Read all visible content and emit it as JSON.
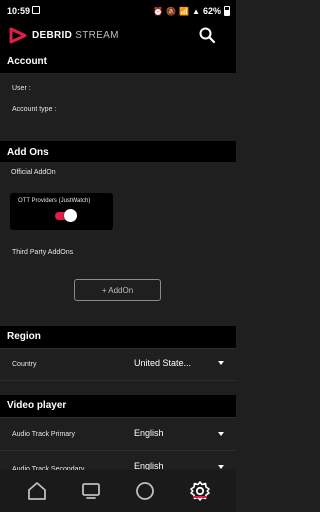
{
  "status_bar": {
    "time": "10:59",
    "battery": "62%",
    "icons": [
      "gallery-icon",
      "alarm-icon",
      "mute-icon",
      "wifi-icon",
      "signal-icon",
      "battery-icon"
    ]
  },
  "header": {
    "logo_bold": "DEBRID",
    "logo_thin": "STREAM",
    "icons": [
      "play-logo-icon",
      "search-icon"
    ]
  },
  "account": {
    "title": "Account",
    "user_label": "User :",
    "account_type_label": "Account type :"
  },
  "addons": {
    "title": "Add Ons",
    "official_label": "Official AddOn",
    "card_title": "OTT Providers (JustWatch)",
    "ott_enabled": true,
    "third_party_label": "Third Party AddOns",
    "add_button": "+ AddOn"
  },
  "region": {
    "title": "Region",
    "country_label": "Country",
    "country_value": "United State..."
  },
  "video_player": {
    "title": "Video player",
    "audio_primary_label": "Audio Track Primary",
    "audio_primary_value": "English",
    "audio_secondary_label": "Audio Track Secondary",
    "audio_secondary_value": "English"
  },
  "bottom_nav": {
    "items": [
      "home-icon",
      "tv-icon",
      "circle-icon",
      "settings-icon"
    ],
    "active": "settings-icon"
  },
  "colors": {
    "accent": "#e11d48",
    "background": "#1f1f1f",
    "header": "#000000"
  }
}
